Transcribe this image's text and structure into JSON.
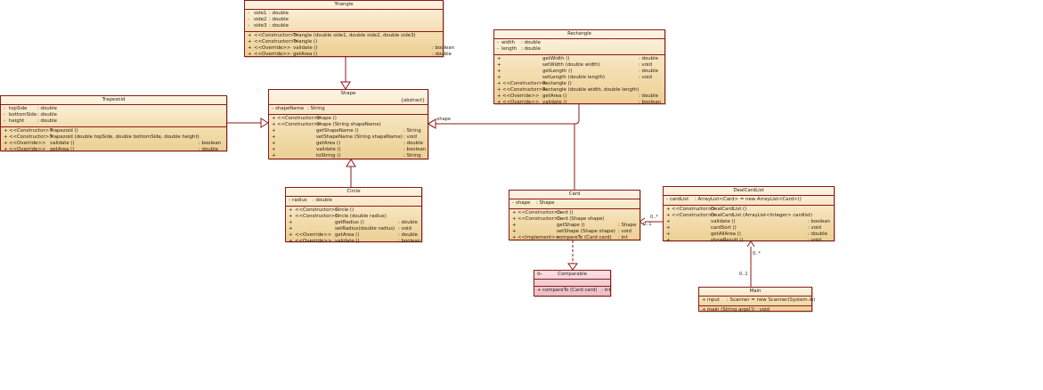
{
  "classes": {
    "triangle": {
      "name": "Triangle",
      "attributes": [
        {
          "vis": "-",
          "name": "side1",
          "type": ": double"
        },
        {
          "vis": "-",
          "name": "side2",
          "type": ": double"
        },
        {
          "vis": "-",
          "name": "side3",
          "type": ": double"
        }
      ],
      "operations": [
        {
          "vis": "+",
          "stereo": "<<Constructor>>",
          "sig": "Triangle (double side1, double side2, double side3)",
          "ret": ""
        },
        {
          "vis": "+",
          "stereo": "<<Constructor>>",
          "sig": "Triangle ()",
          "ret": ""
        },
        {
          "vis": "+",
          "stereo": "<<Override>>",
          "sig": "validate ()",
          "ret": ": boolean"
        },
        {
          "vis": "+",
          "stereo": "<<Override>>",
          "sig": "getArea ()",
          "ret": ": double"
        }
      ]
    },
    "rectangle": {
      "name": "Rectangle",
      "attributes": [
        {
          "vis": "-",
          "name": "width",
          "type": ": double"
        },
        {
          "vis": "-",
          "name": "length",
          "type": ": double"
        }
      ],
      "operations": [
        {
          "vis": "+",
          "stereo": "",
          "sig": "getWidth ()",
          "ret": ": double"
        },
        {
          "vis": "+",
          "stereo": "",
          "sig": "setWidth (double width)",
          "ret": ": void"
        },
        {
          "vis": "+",
          "stereo": "",
          "sig": "getLength ()",
          "ret": ": double"
        },
        {
          "vis": "+",
          "stereo": "",
          "sig": "setLength (double length)",
          "ret": ": void"
        },
        {
          "vis": "+",
          "stereo": "<<Constructor>>",
          "sig": "Rectangle ()",
          "ret": ""
        },
        {
          "vis": "+",
          "stereo": "<<Constructor>>",
          "sig": "Rectangle (double width, double length)",
          "ret": ""
        },
        {
          "vis": "+",
          "stereo": "<<Override>>",
          "sig": "getArea ()",
          "ret": ": double"
        },
        {
          "vis": "+",
          "stereo": "<<Override>>",
          "sig": "validate ()",
          "ret": ": boolean"
        }
      ]
    },
    "trapezoid": {
      "name": "Trapezoid",
      "attributes": [
        {
          "vis": "-",
          "name": "topSide",
          "type": ": double"
        },
        {
          "vis": "-",
          "name": "bottomSide",
          "type": ": double"
        },
        {
          "vis": "-",
          "name": "height",
          "type": ": double"
        }
      ],
      "operations": [
        {
          "vis": "+",
          "stereo": "<<Constructor>>",
          "sig": "Trapezoid ()",
          "ret": ""
        },
        {
          "vis": "+",
          "stereo": "<<Constructor>>",
          "sig": "Trapezoid (double topSide, double bottomSide, double height)",
          "ret": ""
        },
        {
          "vis": "+",
          "stereo": "<<Override>>",
          "sig": "validate ()",
          "ret": ": boolean"
        },
        {
          "vis": "+",
          "stereo": "<<Override>>",
          "sig": "getArea ()",
          "ret": ": double"
        }
      ]
    },
    "shape": {
      "name": "Shape",
      "modifier": "{abstract}",
      "attributes": [
        {
          "vis": "-",
          "name": "shapeName",
          "type": ": String"
        }
      ],
      "operations": [
        {
          "vis": "+",
          "stereo": "<<Constructor>>",
          "sig": "Shape ()",
          "ret": ""
        },
        {
          "vis": "+",
          "stereo": "<<Constructor>>",
          "sig": "Shape (String shapeName)",
          "ret": ""
        },
        {
          "vis": "+",
          "stereo": "",
          "sig": "getShapeName ()",
          "ret": ": String"
        },
        {
          "vis": "+",
          "stereo": "",
          "sig": "setShapeName (String shapeName)",
          "ret": ": void"
        },
        {
          "vis": "+",
          "stereo": "",
          "sig": "getArea ()",
          "ret": ": double"
        },
        {
          "vis": "+",
          "stereo": "",
          "sig": "validate ()",
          "ret": ": boolean"
        },
        {
          "vis": "+",
          "stereo": "",
          "sig": "toString ()",
          "ret": ": String"
        }
      ]
    },
    "circle": {
      "name": "Circle",
      "attributes": [
        {
          "vis": "-",
          "name": "radius",
          "type": ": double"
        }
      ],
      "operations": [
        {
          "vis": "+",
          "stereo": "<<Constructor>>",
          "sig": "Circle ()",
          "ret": ""
        },
        {
          "vis": "+",
          "stereo": "<<Constructor>>",
          "sig": "Circle (double radius)",
          "ret": ""
        },
        {
          "vis": "+",
          "stereo": "",
          "sig": "getRadius ()",
          "ret": ": double"
        },
        {
          "vis": "+",
          "stereo": "",
          "sig": "setRadius(double radius)",
          "ret": ": void"
        },
        {
          "vis": "+",
          "stereo": "<<Override>>",
          "sig": "getArea ()",
          "ret": ": double"
        },
        {
          "vis": "+",
          "stereo": "<<Override>>",
          "sig": "validate ()",
          "ret": ": boolean"
        }
      ]
    },
    "card": {
      "name": "Card",
      "attributes": [
        {
          "vis": "-",
          "name": "shape",
          "type": ": Shape"
        }
      ],
      "operations": [
        {
          "vis": "+",
          "stereo": "<<Constructor>>",
          "sig": "Card ()",
          "ret": ""
        },
        {
          "vis": "+",
          "stereo": "<<Constructor>>",
          "sig": "Card (Shape shape)",
          "ret": ""
        },
        {
          "vis": "+",
          "stereo": "",
          "sig": "getShape ()",
          "ret": ": Shape"
        },
        {
          "vis": "+",
          "stereo": "",
          "sig": "setShape (Shape shape)",
          "ret": ": void"
        },
        {
          "vis": "+",
          "stereo": "<<Implement>>",
          "sig": "compareTo (Card card)",
          "ret": ": int"
        }
      ]
    },
    "comparable": {
      "name": "Comparable",
      "icon": "o-",
      "attributes": [],
      "operations": [
        {
          "vis": "+",
          "stereo": "",
          "sig": "compareTo (Card card)",
          "ret": ": int"
        }
      ]
    },
    "dealcardlist": {
      "name": "DealCardList",
      "attributes": [
        {
          "vis": "-",
          "name": "cardList",
          "type": ": ArrayList<Card>     = new ArrayList<Card>()"
        }
      ],
      "operations": [
        {
          "vis": "+",
          "stereo": "<<Constructor>>",
          "sig": "DealCardList ()",
          "ret": ""
        },
        {
          "vis": "+",
          "stereo": "<<Constructor>>",
          "sig": "DealCardList (ArrayList<Integer> cardlist)",
          "ret": ""
        },
        {
          "vis": "+",
          "stereo": "",
          "sig": "validate ()",
          "ret": ": boolean"
        },
        {
          "vis": "+",
          "stereo": "",
          "sig": "cardSort ()",
          "ret": ": void"
        },
        {
          "vis": "+",
          "stereo": "",
          "sig": "getAllArea ()",
          "ret": ": double"
        },
        {
          "vis": "+",
          "stereo": "",
          "sig": "showResult ()",
          "ret": ": void"
        }
      ]
    },
    "main": {
      "name": "Main",
      "attributes": [
        {
          "vis": "+",
          "name": "input",
          "type": ": Scanner     = new Scanner(System.in)"
        }
      ],
      "operations": [
        {
          "vis": "+",
          "stereo": "",
          "sig": "main (String args[])",
          "ret": ": void"
        }
      ]
    }
  },
  "labels": {
    "shape_role": "-shape",
    "card_mult_many": "0..*",
    "card_mult_one": "0..1",
    "main_mult_many": "0..*",
    "main_mult_one": "0..1"
  }
}
